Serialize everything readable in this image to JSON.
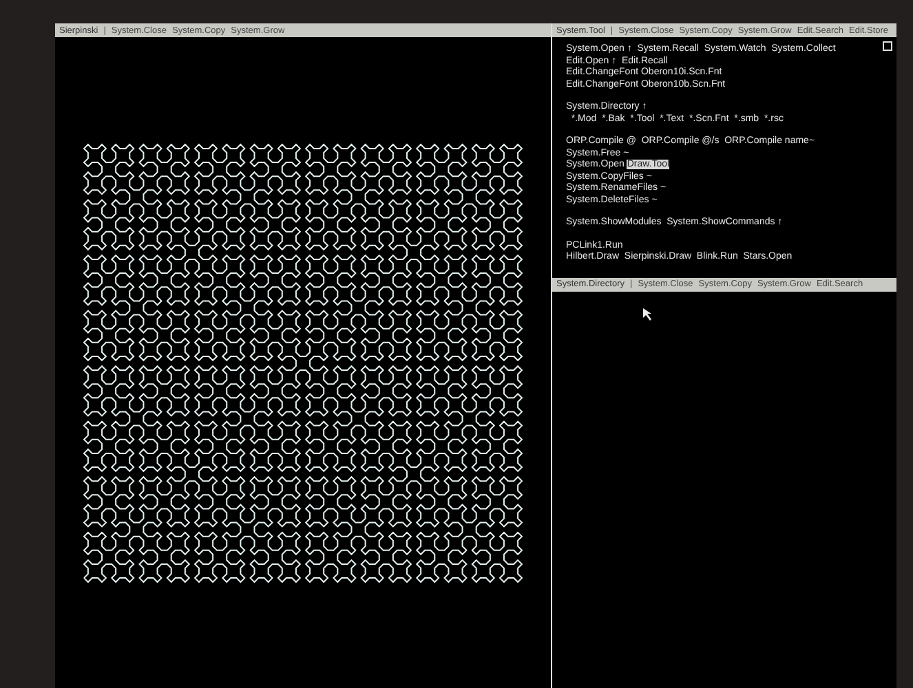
{
  "left_viewer": {
    "title_bar": {
      "name": "Sierpinski",
      "separator": "|",
      "commands": [
        "System.Close",
        "System.Copy",
        "System.Grow"
      ]
    }
  },
  "tool_viewer": {
    "title_bar": {
      "name": "System.Tool",
      "separator": "|",
      "commands": [
        "System.Close",
        "System.Copy",
        "System.Grow",
        "Edit.Search",
        "Edit.Store"
      ]
    },
    "paragraphs": [
      [
        [
          {
            "text": "System.Open ↑  System.Recall  System.Watch  System.Collect",
            "selected": false
          }
        ],
        [
          {
            "text": "Edit.Open ↑  Edit.Recall",
            "selected": false
          }
        ],
        [
          {
            "text": "Edit.ChangeFont Oberon10i.Scn.Fnt",
            "selected": false
          }
        ],
        [
          {
            "text": "Edit.ChangeFont Oberon10b.Scn.Fnt",
            "selected": false
          }
        ]
      ],
      [
        [
          {
            "text": "System.Directory ↑",
            "selected": false
          }
        ],
        [
          {
            "text": "  *.Mod  *.Bak  *.Tool  *.Text  *.Scn.Fnt  *.smb  *.rsc",
            "selected": false
          }
        ]
      ],
      [
        [
          {
            "text": "ORP.Compile @  ORP.Compile @/s  ORP.Compile name~",
            "selected": false
          }
        ],
        [
          {
            "text": "System.Free ~",
            "selected": false
          }
        ],
        [
          {
            "text": "System.Open ",
            "selected": false
          },
          {
            "text": "Draw.Tool",
            "selected": true
          }
        ],
        [
          {
            "text": "System.CopyFiles ~",
            "selected": false
          }
        ],
        [
          {
            "text": "System.RenameFiles ~",
            "selected": false
          }
        ],
        [
          {
            "text": "System.DeleteFiles ~",
            "selected": false
          }
        ]
      ],
      [
        [
          {
            "text": "System.ShowModules  System.ShowCommands ↑",
            "selected": false
          }
        ]
      ],
      [
        [
          {
            "text": "PCLink1.Run",
            "selected": false
          }
        ],
        [
          {
            "text": "Hilbert.Draw  Sierpinski.Draw  Blink.Run  Stars.Open",
            "selected": false
          }
        ]
      ]
    ]
  },
  "directory_viewer": {
    "title_bar": {
      "name": "System.Directory",
      "separator": "|",
      "commands": [
        "System.Close",
        "System.Copy",
        "System.Grow",
        "Edit.Search"
      ]
    }
  }
}
